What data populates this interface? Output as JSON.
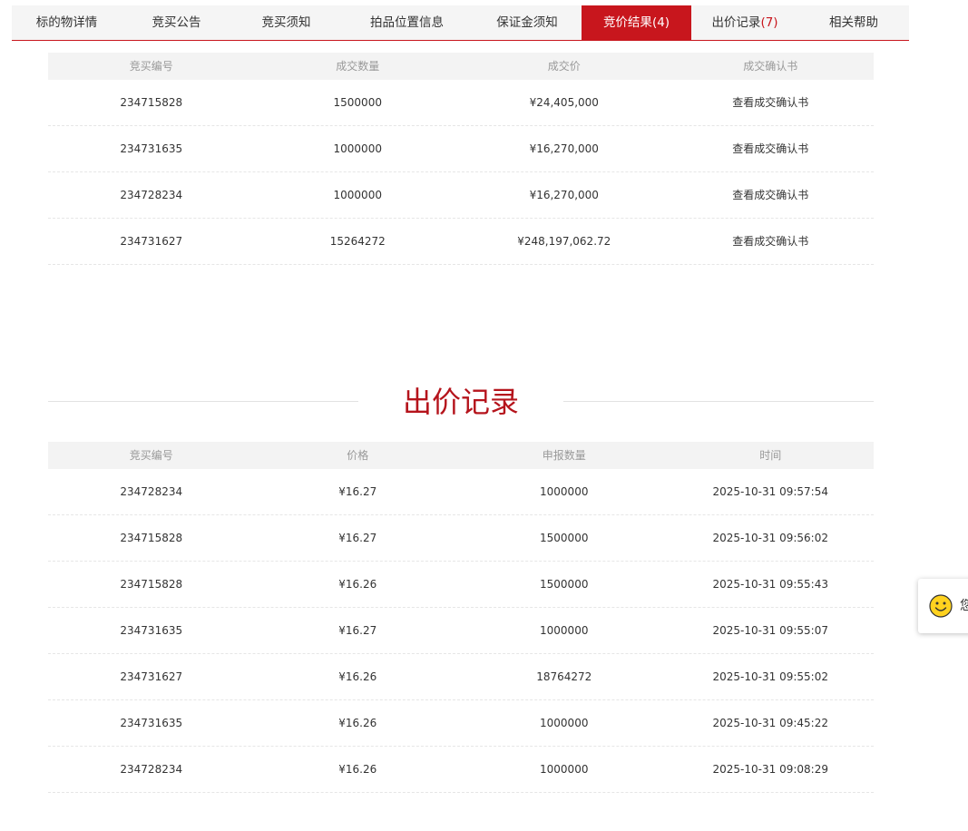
{
  "tabs": [
    {
      "label": "标的物详情",
      "count": ""
    },
    {
      "label": "竞买公告",
      "count": ""
    },
    {
      "label": "竞买须知",
      "count": ""
    },
    {
      "label": "拍品位置信息",
      "count": ""
    },
    {
      "label": "保证金须知",
      "count": ""
    },
    {
      "label": "竞价结果",
      "count": "(4)"
    },
    {
      "label": "出价记录",
      "count": "(7)"
    },
    {
      "label": "相关帮助",
      "count": ""
    }
  ],
  "active_tab": "竞价结果",
  "results": {
    "headers": [
      "竞买编号",
      "成交数量",
      "成交价",
      "成交确认书"
    ],
    "rows": [
      {
        "id": "234715828",
        "qty": "1500000",
        "price": "¥24,405,000",
        "link": "查看成交确认书"
      },
      {
        "id": "234731635",
        "qty": "1000000",
        "price": "¥16,270,000",
        "link": "查看成交确认书"
      },
      {
        "id": "234728234",
        "qty": "1000000",
        "price": "¥16,270,000",
        "link": "查看成交确认书"
      },
      {
        "id": "234731627",
        "qty": "15264272",
        "price": "¥248,197,062.72",
        "link": "查看成交确认书"
      }
    ]
  },
  "bids": {
    "title": "出价记录",
    "headers": [
      "竞买编号",
      "价格",
      "申报数量",
      "时间"
    ],
    "rows": [
      {
        "id": "234728234",
        "price": "¥16.27",
        "qty": "1000000",
        "time": "2025-10-31 09:57:54"
      },
      {
        "id": "234715828",
        "price": "¥16.27",
        "qty": "1500000",
        "time": "2025-10-31 09:56:02"
      },
      {
        "id": "234715828",
        "price": "¥16.26",
        "qty": "1500000",
        "time": "2025-10-31 09:55:43"
      },
      {
        "id": "234731635",
        "price": "¥16.27",
        "qty": "1000000",
        "time": "2025-10-31 09:55:07"
      },
      {
        "id": "234731627",
        "price": "¥16.26",
        "qty": "18764272",
        "time": "2025-10-31 09:55:02"
      },
      {
        "id": "234731635",
        "price": "¥16.26",
        "qty": "1000000",
        "time": "2025-10-31 09:45:22"
      },
      {
        "id": "234728234",
        "price": "¥16.26",
        "qty": "1000000",
        "time": "2025-10-31 09:08:29"
      }
    ]
  },
  "service": {
    "icon": "smiley-icon",
    "text": "您"
  },
  "colors": {
    "accent": "#c8161d",
    "title": "#b5141c",
    "header_bg": "#f3f3f3"
  }
}
